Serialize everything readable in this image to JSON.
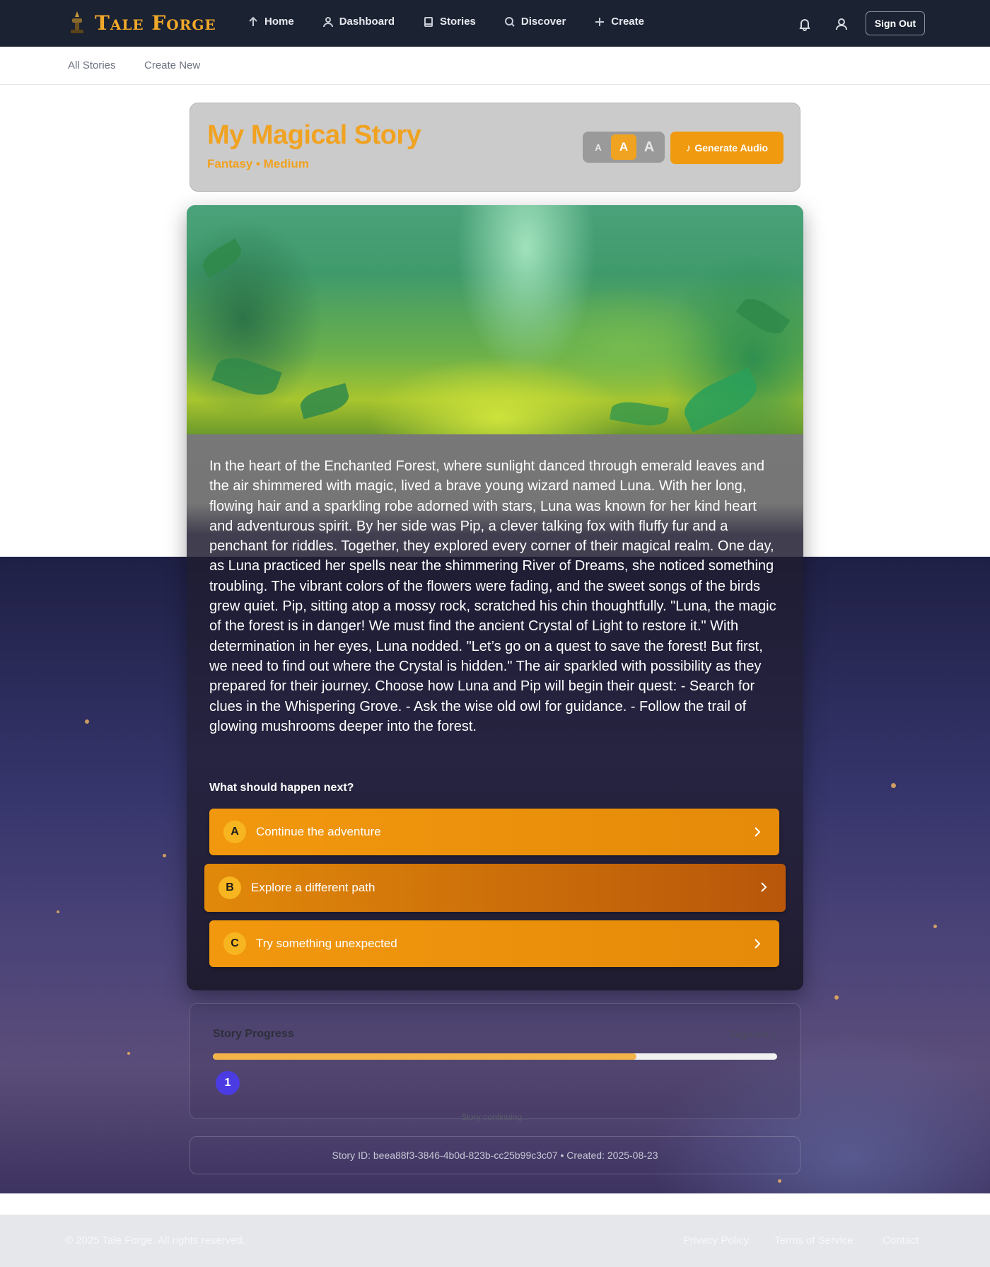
{
  "nav": {
    "brand": "Tale Forge",
    "links": [
      {
        "label": "Home",
        "icon": "arrow-up-icon"
      },
      {
        "label": "Dashboard",
        "icon": "user-icon"
      },
      {
        "label": "Stories",
        "icon": "book-icon"
      },
      {
        "label": "Discover",
        "icon": "search-icon"
      },
      {
        "label": "Create",
        "icon": "plus-icon"
      }
    ],
    "sign_out": "Sign Out"
  },
  "subnav": {
    "all_stories": "All Stories",
    "create_new": "Create New"
  },
  "story": {
    "title": "My Magical Story",
    "meta": "Fantasy • Medium",
    "font_sizes": [
      "A",
      "A",
      "A"
    ],
    "active_font_size": 1,
    "generate_audio": "Generate Audio",
    "text": "In the heart of the Enchanted Forest, where sunlight danced through emerald leaves and the air shimmered with magic, lived a brave young wizard named Luna. With her long, flowing hair and a sparkling robe adorned with stars, Luna was known for her kind heart and adventurous spirit. By her side was Pip, a clever talking fox with fluffy fur and a penchant for riddles. Together, they explored every corner of their magical realm. One day, as Luna practiced her spells near the shimmering River of Dreams, she noticed something troubling. The vibrant colors of the flowers were fading, and the sweet songs of the birds grew quiet. Pip, sitting atop a mossy rock, scratched his chin thoughtfully. \"Luna, the magic of the forest is in danger! We must find the ancient Crystal of Light to restore it.\" With determination in her eyes, Luna nodded. \"Let’s go on a quest to save the forest! But first, we need to find out where the Crystal is hidden.\" The air sparkled with possibility as they prepared for their journey. Choose how Luna and Pip will begin their quest: - Search for clues in the Whispering Grove. - Ask the wise old owl for guidance. - Follow the trail of glowing mushrooms deeper into the forest.",
    "next_question": "What should happen next?",
    "choices": [
      {
        "letter": "A",
        "label": "Continue the adventure"
      },
      {
        "letter": "B",
        "label": "Explore a different path"
      },
      {
        "letter": "C",
        "label": "Try something unexpected"
      }
    ]
  },
  "progress": {
    "title": "Story Progress",
    "segment": "Segment 1",
    "fraction": 0.75,
    "status": "Story continuing...",
    "current_segment": "1"
  },
  "story_info": "Story ID: beea88f3-3846-4b0d-823b-cc25b99c3c07 • Created: 2025-08-23",
  "footer": {
    "copyright": "© 2025 Tale Forge. All rights reserved.",
    "links": [
      "Privacy Policy",
      "Terms of Service",
      "Contact"
    ]
  },
  "colors": {
    "accent": "#f0a221",
    "nav_bg": "#1b2232",
    "segment_dot": "#4b3be3"
  }
}
